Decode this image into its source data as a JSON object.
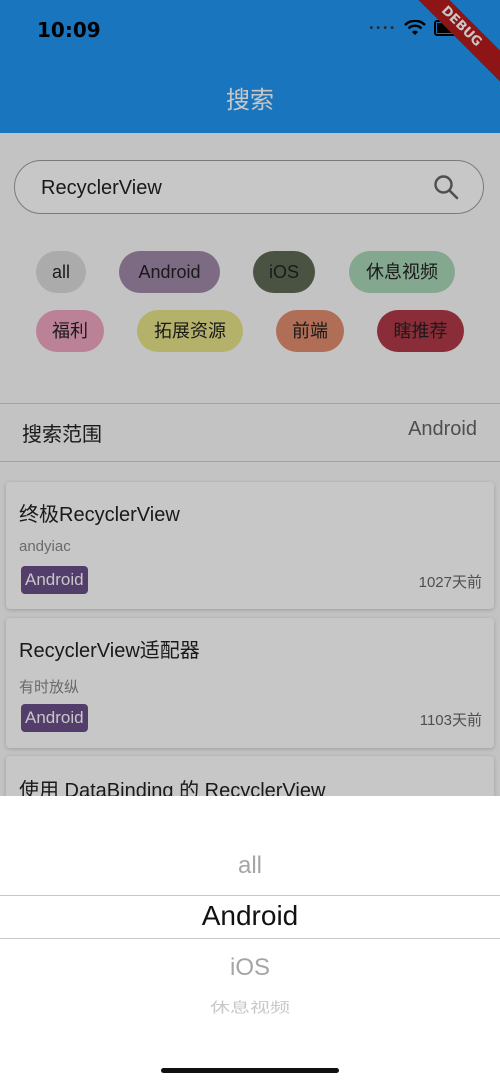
{
  "status": {
    "time": "10:09"
  },
  "debug_banner": "DEBUG",
  "app": {
    "title": "搜索"
  },
  "search": {
    "value": "RecyclerView",
    "placeholder": ""
  },
  "tags": [
    {
      "label": "all",
      "color": "#dcdcdc"
    },
    {
      "label": "Android",
      "color": "#a08aa8"
    },
    {
      "label": "iOS",
      "color": "#5f6b55"
    },
    {
      "label": "休息视频",
      "color": "#a9d6b8"
    },
    {
      "label": "福利",
      "color": "#f0a6c0"
    },
    {
      "label": "拓展资源",
      "color": "#e7e38a"
    },
    {
      "label": "前端",
      "color": "#e08d6e"
    },
    {
      "label": "瞎推荐",
      "color": "#b23a48"
    }
  ],
  "scope": {
    "label": "搜索范围",
    "value": "Android"
  },
  "results": [
    {
      "title": "终极RecyclerView",
      "author": "andyiac",
      "category": "Android",
      "time": "1027天前"
    },
    {
      "title": "RecyclerView适配器",
      "author": "有时放纵",
      "category": "Android",
      "time": "1103天前"
    },
    {
      "title": "使用 DataBinding 的 RecyclerView",
      "author": "",
      "category": "",
      "time": ""
    }
  ],
  "picker": {
    "options": [
      "all",
      "Android",
      "iOS",
      "休息视频"
    ],
    "selected": "Android"
  },
  "colors": {
    "appbar": "#2196f3",
    "chip": "#6b4f8a"
  }
}
